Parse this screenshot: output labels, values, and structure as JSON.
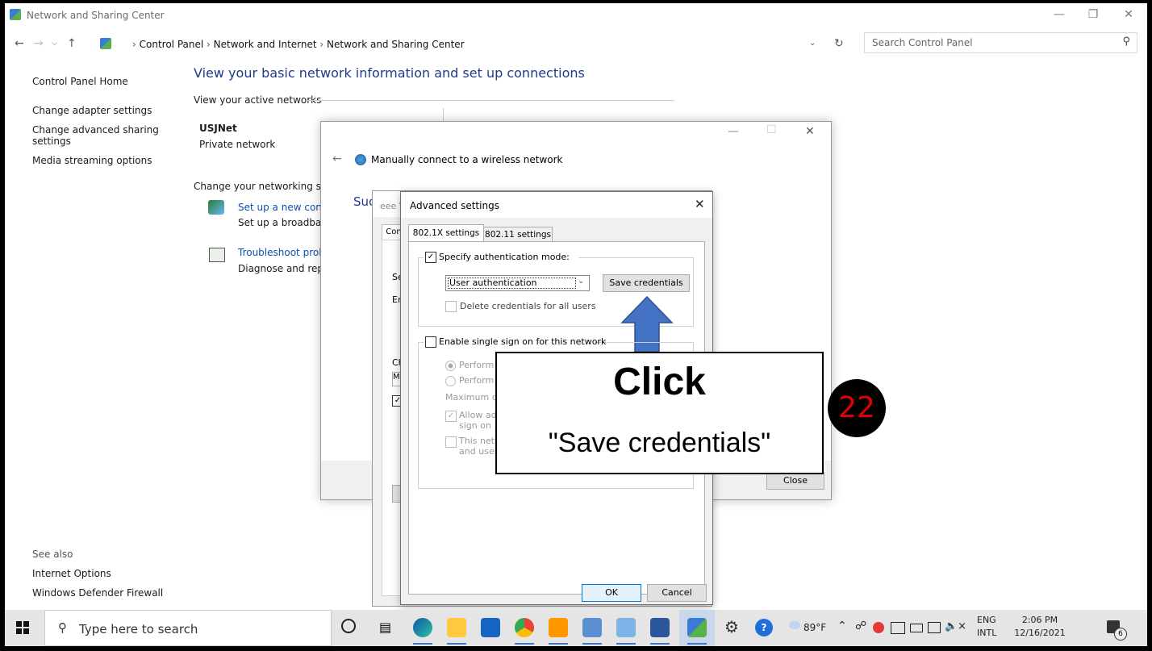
{
  "window": {
    "title": "Network and Sharing Center"
  },
  "address": {
    "crumb_root": "Control Panel",
    "crumb_mid": "Network and Internet",
    "crumb_leaf": "Network and Sharing Center",
    "search_placeholder": "Search Control Panel"
  },
  "sidebar": {
    "home": "Control Panel Home",
    "items": [
      "Change adapter settings",
      "Change advanced sharing",
      "settings",
      "Media streaming options"
    ],
    "see_also": "See also",
    "links": [
      "Internet Options",
      "Windows Defender Firewall"
    ]
  },
  "main": {
    "heading": "View your basic network information and set up connections",
    "active_networks": "View your active networks",
    "network_name": "USJNet",
    "network_type": "Private network",
    "change_settings": "Change your networking sett",
    "setup_link": "Set up a new conne",
    "setup_desc": "Set up a broadbanc",
    "troubleshoot_link": "Troubleshoot probl",
    "troubleshoot_desc": "Diagnose and repai"
  },
  "wizard": {
    "title": "Manually connect to a wireless network",
    "success_text": "Suc",
    "close": "Close"
  },
  "props_dialog": {
    "title_fragment": "eee V",
    "tab_fragment": "Con",
    "row_labels": [
      "Se",
      "En",
      "Ch",
      "M"
    ]
  },
  "advanced": {
    "title": "Advanced settings",
    "tabs": [
      "802.1X settings",
      "802.11 settings"
    ],
    "specify_auth": "Specify authentication mode:",
    "auth_mode": "User authentication",
    "save_credentials": "Save credentials",
    "delete_credentials": "Delete credentials for all users",
    "enable_sso": "Enable single sign on for this network",
    "perform_1": "Perform im",
    "perform_2": "Perform im",
    "max_delay": "Maximum dela",
    "allow_1": "Allow additi",
    "allow_2": "sign on",
    "this_net_1": "This netwo",
    "this_net_2": "and user a",
    "ok": "OK",
    "cancel": "Cancel"
  },
  "callout": {
    "line1": "Click",
    "line2": "\"Save credentials\"",
    "step": "22"
  },
  "taskbar": {
    "search_placeholder": "Type here to search",
    "weather": "89°F",
    "lang1": "ENG",
    "lang2": "INTL",
    "time": "2:06 PM",
    "date": "12/16/2021",
    "notif_count": "6"
  },
  "colors": {
    "accent": "#0a4fb0",
    "arrow": "#4472c4",
    "badge_text": "#e40000"
  }
}
